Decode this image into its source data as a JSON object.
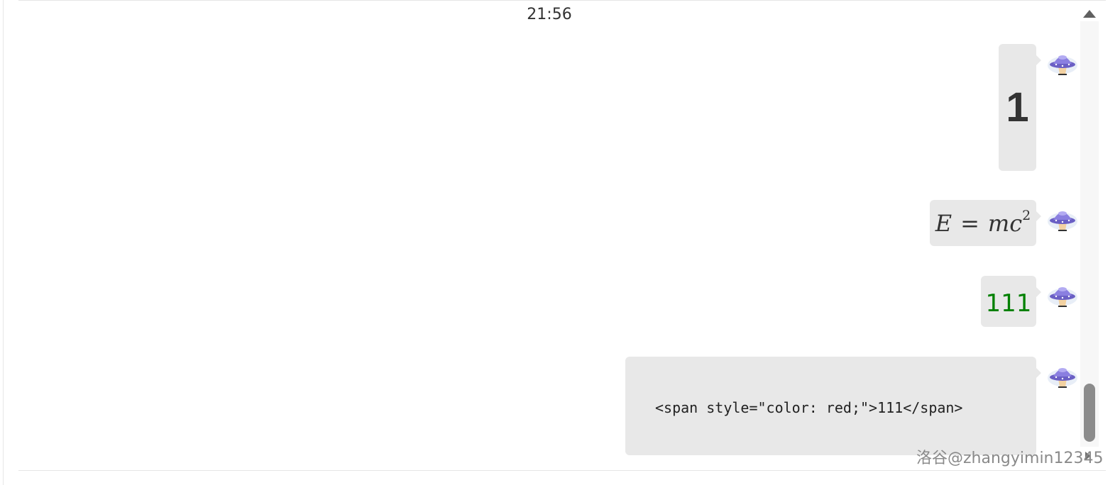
{
  "chat": {
    "timestamp": "21:56",
    "messages": [
      {
        "type": "heading",
        "text": "1"
      },
      {
        "type": "math",
        "latex_parts": {
          "left": "E",
          "eq": "=",
          "m": "m",
          "c": "c",
          "exp": "2"
        }
      },
      {
        "type": "colored-text",
        "text": "111",
        "color": "#008000"
      },
      {
        "type": "code",
        "text": "<span style=\"color: red;\">111</span>"
      }
    ],
    "avatar_icon": "ufo-icon"
  },
  "scrollbar": {
    "up_icon": "triangle-up-icon",
    "down_icon": "triangle-right-icon"
  },
  "watermark": "洛谷@zhangyimin12345"
}
